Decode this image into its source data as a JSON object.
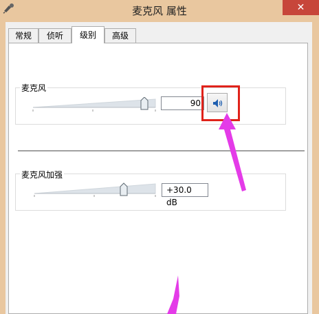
{
  "window": {
    "title": "麦克风 属性",
    "close_label": "✕"
  },
  "tabs": [
    {
      "label": "常规",
      "active": false
    },
    {
      "label": "侦听",
      "active": false
    },
    {
      "label": "级别",
      "active": true
    },
    {
      "label": "高级",
      "active": false
    }
  ],
  "microphone": {
    "label": "麦克风",
    "level_value": "90",
    "level_fraction": 0.9,
    "speaker_icon": "speaker-volume-icon"
  },
  "boost": {
    "label": "麦克风加强",
    "value": "+30.0 dB",
    "level_fraction": 0.75
  },
  "colors": {
    "titlebar": "#e9c79f",
    "close": "#c7463a",
    "annotation_box": "#e0221a",
    "annotation_arrow": "#e43be8"
  }
}
